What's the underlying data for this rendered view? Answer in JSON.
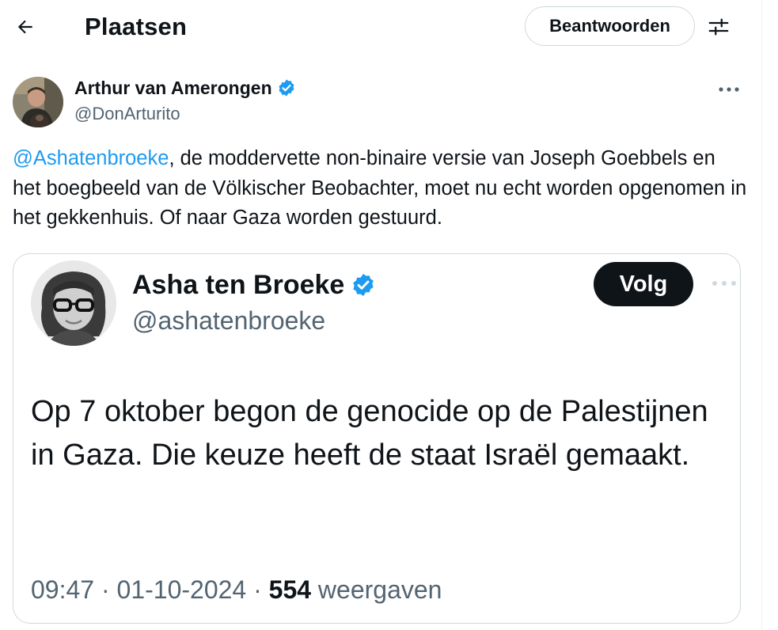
{
  "header": {
    "title": "Plaatsen",
    "reply_label": "Beantwoorden"
  },
  "tweet": {
    "author_name": "Arthur van Amerongen",
    "author_handle": "@DonArturito",
    "mention": "@Ashatenbroeke",
    "text": ", de moddervette non-binaire versie van Joseph Goebbels en het boegbeeld van de Völkischer Beobachter, moet nu echt worden opgenomen in het gekkenhuis. Of naar Gaza worden gestuurd."
  },
  "quote": {
    "author_name": "Asha ten Broeke",
    "author_handle": "@ashatenbroeke",
    "follow_label": "Volg",
    "text": "Op 7 oktober begon de genocide op de Palestijnen in Gaza. Die keuze heeft de staat Israël gemaakt.",
    "time": "09:47",
    "separator": " · ",
    "date": "01-10-2024",
    "views_count": "554",
    "views_label": "weergaven"
  },
  "colors": {
    "accent": "#1d9bf0",
    "text_primary": "#0f1419",
    "text_secondary": "#536471",
    "border": "#cfd9de"
  },
  "icons": {
    "back": "arrow-left-icon",
    "settings": "sliders-icon",
    "more": "more-horizontal-icon",
    "verified": "verified-badge-icon"
  }
}
